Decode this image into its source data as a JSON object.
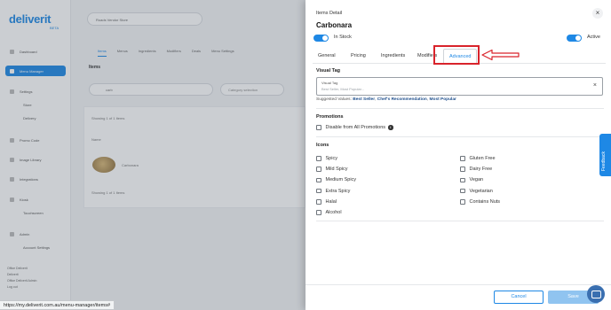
{
  "background": {
    "logo": "deliverit",
    "logo_sub": "BETA",
    "nav": [
      {
        "label": "Dashboard",
        "active": false
      },
      {
        "label": "Menu Manager",
        "active": true
      },
      {
        "label": "Settings",
        "active": false
      },
      {
        "label": "Store",
        "active": false,
        "sub": true
      },
      {
        "label": "Delivery",
        "active": false,
        "sub": true
      },
      {
        "label": "Promo Code",
        "active": false
      },
      {
        "label": "Image Library",
        "active": false
      },
      {
        "label": "Integrations",
        "active": false
      },
      {
        "label": "Kiosk",
        "active": false
      },
      {
        "label": "Touchscreen",
        "active": false,
        "sub": true
      },
      {
        "label": "Admin",
        "active": false
      },
      {
        "label": "Account Settings",
        "active": false,
        "sub": true
      }
    ],
    "user_lines": [
      "Office Deliverit",
      "Deliverit",
      "Office Deliverit Admin",
      "Log out"
    ],
    "store_select": "Roads Vendor Store",
    "tabs": [
      "Items",
      "Menus",
      "Ingredients",
      "Modifiers",
      "Deals",
      "Menu Settings"
    ],
    "items_heading": "Items",
    "search_value": "carb",
    "category_select": "Category selection",
    "showing_top": "Showing 1 of 1 Items",
    "name_header": "Name",
    "row_item": "Carbonara",
    "showing_bottom": "Showing 1 of 1 Items"
  },
  "drawer": {
    "title": "Items Detail",
    "item_name": "Carbonara",
    "in_stock_label": "In Stock",
    "active_label": "Active",
    "tabs": [
      {
        "label": "General",
        "active": false
      },
      {
        "label": "Pricing",
        "active": false
      },
      {
        "label": "Ingredients",
        "active": false
      },
      {
        "label": "Modifiers",
        "active": false
      },
      {
        "label": "Advanced",
        "active": true
      }
    ],
    "visual_tag": {
      "heading": "Visual Tag",
      "field_label": "Visual Tag",
      "placeholder": "Best Seller, Most Popular...",
      "suggested_prefix": "Suggested Values:",
      "suggested": [
        "Best Seller",
        "Chef's Recommendation",
        "Most Popular"
      ]
    },
    "promotions": {
      "heading": "Promotions",
      "option": "Disable from All Promotions"
    },
    "icons": {
      "heading": "Icons",
      "left": [
        "Spicy",
        "Mild Spicy",
        "Medium Spicy",
        "Extra Spicy",
        "Halal",
        "Alcohol"
      ],
      "right": [
        "Gluten Free",
        "Dairy Free",
        "Vegan",
        "Vegetarian",
        "Contains Nuts"
      ]
    },
    "cancel_label": "Cancel",
    "save_label": "Save"
  },
  "feedback_label": "Feedback",
  "status_url": "https://my.deliverit.com.au/menu-manager/items#",
  "colors": {
    "accent": "#1e88e5",
    "highlight": "#d9232b",
    "save_disabled": "#90c4f0"
  },
  "icon_names": [
    "close-icon",
    "info-icon",
    "search-icon",
    "chat-icon",
    "arrow-left-icon"
  ]
}
